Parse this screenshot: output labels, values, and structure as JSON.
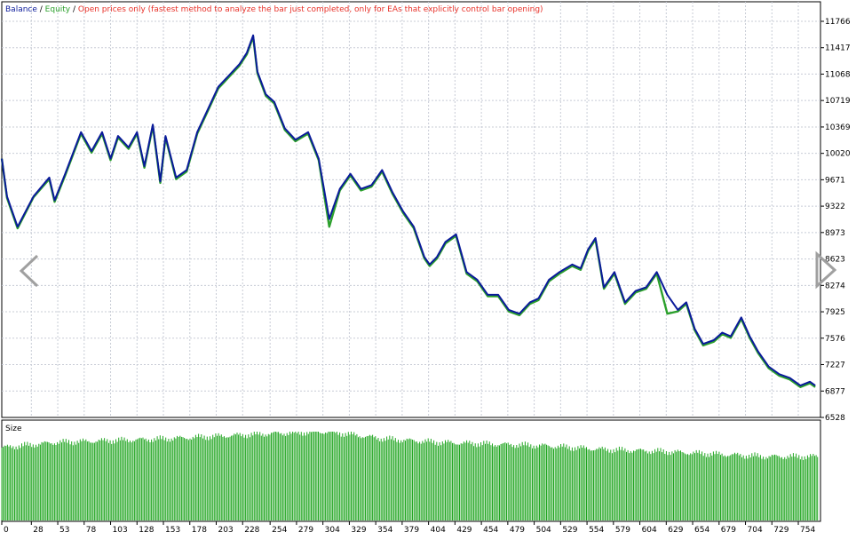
{
  "colors": {
    "balance": "#0a1a9a",
    "equity": "#2ca02c",
    "mode_text": "#e8322a",
    "grid": "#c8ccd6",
    "frame": "#000000",
    "size_bars": "#1fa51f",
    "nav_arrows": "#a0a0a0"
  },
  "legend": {
    "balance": "Balance",
    "sep1": " / ",
    "equity": "Equity",
    "sep2": " / ",
    "mode": "Open prices only (fastest method to analyze the bar just completed, only for EAs that explicitly control bar opening)"
  },
  "size_panel": {
    "label": "Size"
  },
  "icons": {
    "left": "chevron-left-icon",
    "right": "chevron-right-icon"
  },
  "chart_data": {
    "type": "line",
    "x_ticks": [
      "0",
      "28",
      "53",
      "78",
      "103",
      "128",
      "153",
      "178",
      "203",
      "228",
      "254",
      "279",
      "304",
      "329",
      "354",
      "379",
      "404",
      "429",
      "454",
      "479",
      "504",
      "529",
      "554",
      "579",
      "604",
      "629",
      "654",
      "679",
      "704",
      "729",
      "754"
    ],
    "y_ticks": [
      "11766",
      "11417",
      "11068",
      "10719",
      "10369",
      "10020",
      "9671",
      "9322",
      "8973",
      "8623",
      "8274",
      "7925",
      "7576",
      "7227",
      "6877",
      "6528"
    ],
    "xlim": [
      0,
      775
    ],
    "ylim": [
      6528,
      11950
    ],
    "series": [
      {
        "name": "Balance",
        "x": [
          0,
          5,
          15,
          30,
          45,
          50,
          60,
          75,
          85,
          95,
          103,
          110,
          120,
          128,
          135,
          143,
          150,
          155,
          165,
          175,
          185,
          195,
          205,
          215,
          225,
          232,
          238,
          242,
          250,
          258,
          268,
          278,
          290,
          300,
          310,
          320,
          330,
          340,
          350,
          360,
          370,
          380,
          390,
          400,
          405,
          412,
          420,
          430,
          440,
          450,
          460,
          470,
          480,
          490,
          500,
          508,
          518,
          528,
          540,
          548,
          555,
          562,
          570,
          580,
          590,
          600,
          610,
          620,
          630,
          640,
          648,
          656,
          664,
          674,
          682,
          690,
          700,
          708,
          716,
          726,
          736,
          746,
          756,
          765,
          770
        ],
        "y": [
          9950,
          9450,
          9050,
          9450,
          9700,
          9400,
          9750,
          10300,
          10050,
          10300,
          9950,
          10250,
          10100,
          10300,
          9850,
          10400,
          9650,
          10250,
          9700,
          9800,
          10300,
          10600,
          10900,
          11050,
          11200,
          11350,
          11580,
          11100,
          10800,
          10700,
          10350,
          10200,
          10300,
          9950,
          9150,
          9550,
          9750,
          9550,
          9600,
          9800,
          9500,
          9250,
          9050,
          8650,
          8550,
          8650,
          8850,
          8950,
          8450,
          8350,
          8150,
          8150,
          7950,
          7900,
          8050,
          8100,
          8350,
          8450,
          8550,
          8500,
          8750,
          8900,
          8250,
          8450,
          8050,
          8200,
          8250,
          8450,
          8150,
          7950,
          8050,
          7700,
          7500,
          7550,
          7650,
          7600,
          7850,
          7600,
          7400,
          7200,
          7100,
          7050,
          6950,
          7000,
          6950
        ]
      },
      {
        "name": "Equity",
        "x": [
          0,
          5,
          15,
          30,
          45,
          50,
          60,
          75,
          85,
          95,
          103,
          110,
          120,
          128,
          135,
          143,
          150,
          155,
          165,
          175,
          185,
          195,
          205,
          215,
          225,
          232,
          238,
          242,
          250,
          258,
          268,
          278,
          290,
          300,
          310,
          320,
          330,
          340,
          350,
          360,
          370,
          380,
          390,
          400,
          405,
          412,
          420,
          430,
          440,
          450,
          460,
          470,
          480,
          490,
          500,
          508,
          518,
          528,
          540,
          548,
          555,
          562,
          570,
          580,
          590,
          600,
          610,
          620,
          630,
          640,
          648,
          656,
          664,
          674,
          682,
          690,
          700,
          708,
          716,
          726,
          736,
          746,
          756,
          765,
          770
        ],
        "y": [
          9950,
          9430,
          9030,
          9440,
          9680,
          9380,
          9730,
          10280,
          10030,
          10280,
          9930,
          10230,
          10080,
          10280,
          9830,
          10380,
          9630,
          10230,
          9680,
          9780,
          10280,
          10580,
          10880,
          11030,
          11180,
          11330,
          11560,
          11080,
          10780,
          10680,
          10330,
          10180,
          10280,
          9930,
          9050,
          9530,
          9730,
          9530,
          9580,
          9780,
          9480,
          9230,
          9030,
          8630,
          8530,
          8630,
          8830,
          8930,
          8430,
          8330,
          8130,
          8130,
          7930,
          7880,
          8030,
          8080,
          8330,
          8430,
          8530,
          8480,
          8730,
          8880,
          8230,
          8430,
          8030,
          8180,
          8230,
          8430,
          7900,
          7930,
          8030,
          7680,
          7480,
          7530,
          7630,
          7580,
          7830,
          7580,
          7380,
          7180,
          7080,
          7030,
          6930,
          6980,
          6930
        ]
      }
    ],
    "size_series": {
      "name": "Size",
      "min": 0,
      "max": 1,
      "levels": [
        0.82,
        0.88,
        0.9,
        0.92,
        0.95,
        0.98,
        1.0,
        0.92,
        0.88,
        0.86,
        0.84,
        0.8,
        0.78,
        0.75,
        0.72,
        0.72
      ]
    }
  }
}
